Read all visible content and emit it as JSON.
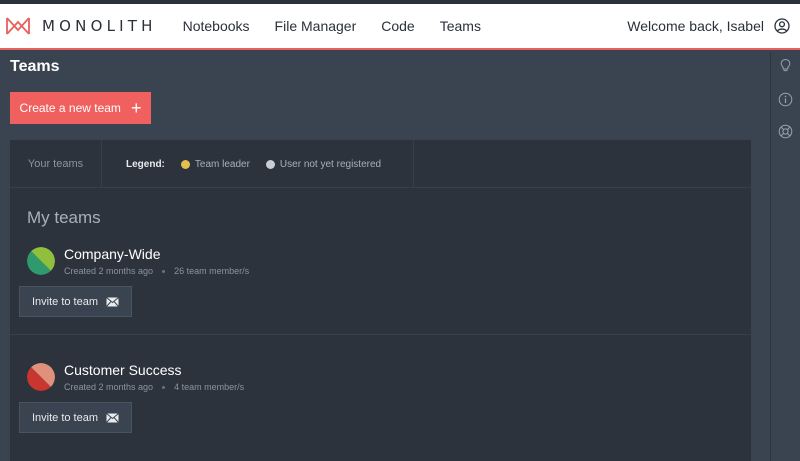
{
  "brand": {
    "name": "MONOLITH",
    "accent": "#f0605e"
  },
  "nav": {
    "links": [
      "Notebooks",
      "File Manager",
      "Code",
      "Teams"
    ],
    "welcome": "Welcome back, Isabel"
  },
  "rail_icons": [
    "lightbulb-icon",
    "info-icon",
    "support-icon"
  ],
  "page": {
    "title": "Teams",
    "create_button": "Create a new team",
    "create_icon": "+"
  },
  "panel": {
    "tab_label": "Your teams",
    "legend": {
      "title": "Legend:",
      "items": [
        {
          "label": "Team leader",
          "color": "#e5c04d"
        },
        {
          "label": "User not yet registered",
          "color": "#c9ced4"
        }
      ]
    },
    "section_title": "My teams"
  },
  "teams": [
    {
      "name": "Company-Wide",
      "created": "Created 2 months ago",
      "members": "26 team member/s",
      "invite_label": "Invite to team",
      "colors": [
        "#2f9a6c",
        "#8fbf3c"
      ]
    },
    {
      "name": "Customer Success",
      "created": "Created 2 months ago",
      "members": "4 team member/s",
      "invite_label": "Invite to team",
      "colors": [
        "#c9352f",
        "#e0917c"
      ]
    }
  ]
}
